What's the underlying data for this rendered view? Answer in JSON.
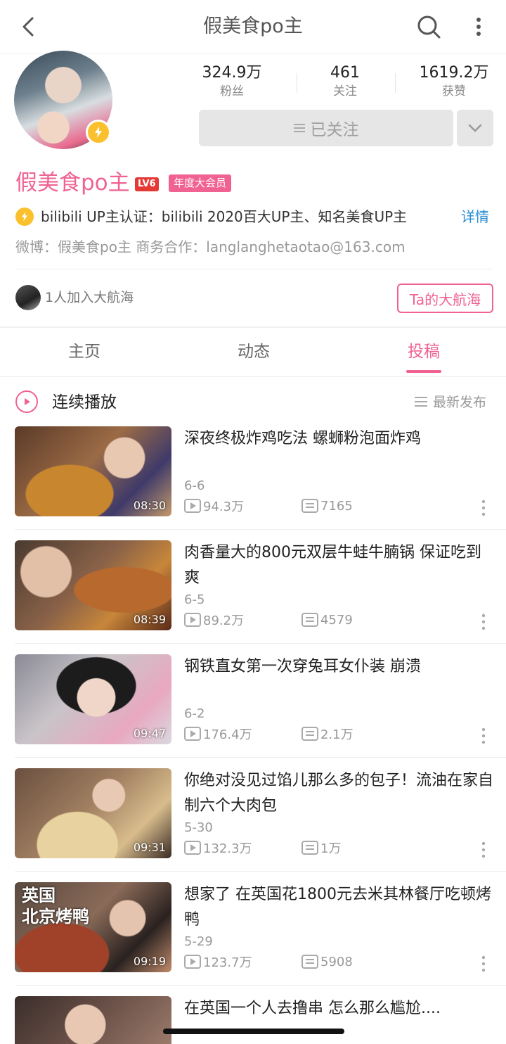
{
  "header": {
    "title": "假美食po主",
    "icons": [
      "back-icon",
      "search-icon",
      "more-vertical-icon"
    ]
  },
  "profile": {
    "stats": [
      {
        "value": "324.9万",
        "label": "粉丝"
      },
      {
        "value": "461",
        "label": "关注"
      },
      {
        "value": "1619.2万",
        "label": "获赞"
      }
    ],
    "follow_label": "已关注",
    "name": "假美食po主",
    "level": "LV6",
    "vip_badge": "年度大会员",
    "verification": "bilibili  UP主认证：bilibili  2020百大UP主、知名美食UP主",
    "detail_link": "详情",
    "weibo_line": "微博：假美食po主    商务合作：langlanghetaotao@163.com",
    "crew_text": "1人加入大航海",
    "crew_button": "Ta的大航海"
  },
  "tabs": [
    {
      "label": "主页",
      "active": false
    },
    {
      "label": "动态",
      "active": false
    },
    {
      "label": "投稿",
      "active": true
    }
  ],
  "playlist": {
    "play_label": "连续播放",
    "sort_label": "最新发布"
  },
  "videos": [
    {
      "title": "深夜终极炸鸡吃法  螺蛳粉泡面炸鸡",
      "duration": "08:30",
      "date": "6-6",
      "views": "94.3万",
      "danmaku": "7165"
    },
    {
      "title": "肉香量大的800元双层牛蛙牛腩锅  保证吃到爽",
      "duration": "08:39",
      "date": "6-5",
      "views": "89.2万",
      "danmaku": "4579"
    },
    {
      "title": "钢铁直女第一次穿兔耳女仆装  崩溃",
      "duration": "09:47",
      "date": "6-2",
      "views": "176.4万",
      "danmaku": "2.1万"
    },
    {
      "title": "你绝对没见过馅儿那么多的包子！流油在家自制六个大肉包",
      "duration": "09:31",
      "date": "5-30",
      "views": "132.3万",
      "danmaku": "1万"
    },
    {
      "title": "想家了  在英国花1800元去米其林餐厅吃顿烤鸭",
      "duration": "09:19",
      "date": "5-29",
      "views": "123.7万",
      "danmaku": "5908",
      "thumb_text": "英国\n北京烤鸭"
    },
    {
      "title": "在英国一个人去撸串  怎么那么尴尬....",
      "duration": "",
      "date": "",
      "views": "",
      "danmaku": ""
    }
  ],
  "colors": {
    "accent": "#f06292",
    "link": "#2b8fd6",
    "badge_gold": "#fbc02d"
  }
}
